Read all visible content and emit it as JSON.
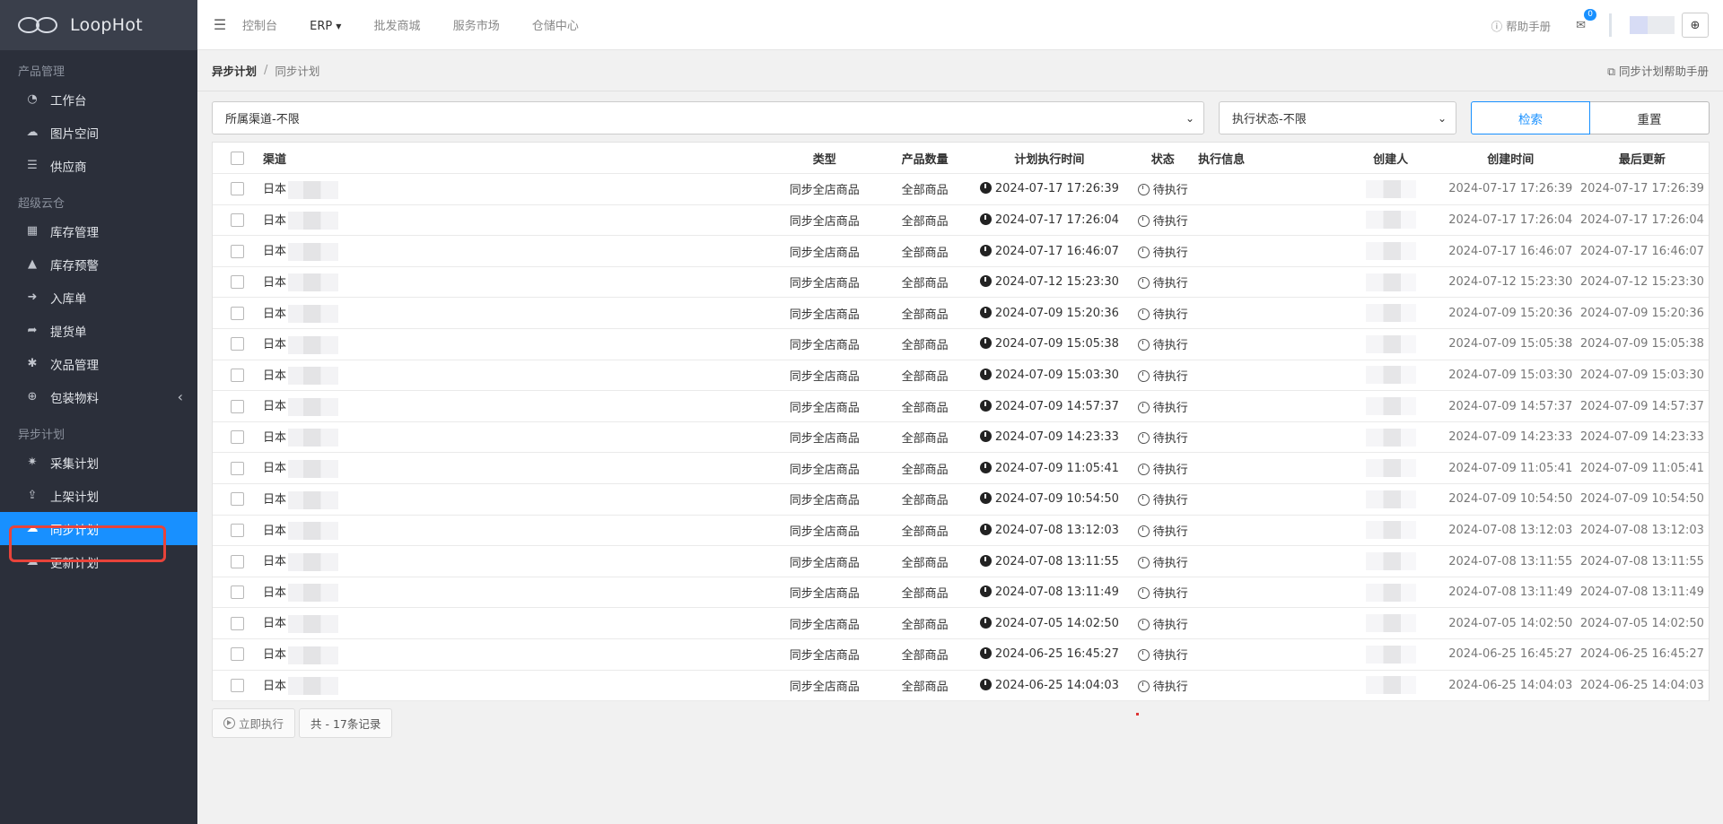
{
  "brand": {
    "name": "LoopHot"
  },
  "sidebar": {
    "groups": [
      {
        "title": "产品管理",
        "items": [
          {
            "label": "工作台",
            "icon": "dashboard-icon",
            "glyph": "◔"
          },
          {
            "label": "图片空间",
            "icon": "cloud-icon",
            "glyph": "☁"
          },
          {
            "label": "供应商",
            "icon": "list-icon",
            "glyph": "☰"
          }
        ]
      },
      {
        "title": "超级云仓",
        "items": [
          {
            "label": "库存管理",
            "icon": "cubes-icon",
            "glyph": "▦"
          },
          {
            "label": "库存预警",
            "icon": "warning-icon",
            "glyph": "▲"
          },
          {
            "label": "入库单",
            "icon": "sign-in-icon",
            "glyph": "➜"
          },
          {
            "label": "提货单",
            "icon": "sign-out-icon",
            "glyph": "➦"
          },
          {
            "label": "次品管理",
            "icon": "bug-icon",
            "glyph": "✱"
          },
          {
            "label": "包装物料",
            "icon": "search-plus-icon",
            "glyph": "⊕",
            "expandable": true
          }
        ]
      },
      {
        "title": "异步计划",
        "items": [
          {
            "label": "采集计划",
            "icon": "spider-icon",
            "glyph": "✷"
          },
          {
            "label": "上架计划",
            "icon": "upload-icon",
            "glyph": "⇪"
          },
          {
            "label": "同步计划",
            "icon": "cloud-download-icon",
            "glyph": "☁",
            "active": true
          },
          {
            "label": "更新计划",
            "icon": "cloud-upload-icon",
            "glyph": "☁"
          }
        ]
      }
    ]
  },
  "topbar": {
    "nav": [
      "控制台",
      "ERP",
      "批发商城",
      "服务市场",
      "仓储中心"
    ],
    "help": "帮助手册",
    "mail_badge": "0"
  },
  "breadcrumb": {
    "parent": "异步计划",
    "current": "同步计划",
    "help": "同步计划帮助手册"
  },
  "filters": {
    "channel": "所属渠道-不限",
    "status": "执行状态-不限",
    "search": "检索",
    "reset": "重置"
  },
  "table": {
    "columns": [
      "渠道",
      "类型",
      "产品数量",
      "计划执行时间",
      "状态",
      "执行信息",
      "创建人",
      "创建时间",
      "最后更新"
    ],
    "rows": [
      {
        "channel": "日本",
        "type": "同步全店商品",
        "qty": "全部商品",
        "plan_time": "2024-07-17 17:26:39",
        "status": "待执行",
        "created": "2024-07-17 17:26:39",
        "updated": "2024-07-17 17:26:39"
      },
      {
        "channel": "日本",
        "type": "同步全店商品",
        "qty": "全部商品",
        "plan_time": "2024-07-17 17:26:04",
        "status": "待执行",
        "created": "2024-07-17 17:26:04",
        "updated": "2024-07-17 17:26:04"
      },
      {
        "channel": "日本",
        "type": "同步全店商品",
        "qty": "全部商品",
        "plan_time": "2024-07-17 16:46:07",
        "status": "待执行",
        "created": "2024-07-17 16:46:07",
        "updated": "2024-07-17 16:46:07"
      },
      {
        "channel": "日本",
        "type": "同步全店商品",
        "qty": "全部商品",
        "plan_time": "2024-07-12 15:23:30",
        "status": "待执行",
        "created": "2024-07-12 15:23:30",
        "updated": "2024-07-12 15:23:30"
      },
      {
        "channel": "日本",
        "type": "同步全店商品",
        "qty": "全部商品",
        "plan_time": "2024-07-09 15:20:36",
        "status": "待执行",
        "created": "2024-07-09 15:20:36",
        "updated": "2024-07-09 15:20:36"
      },
      {
        "channel": "日本",
        "type": "同步全店商品",
        "qty": "全部商品",
        "plan_time": "2024-07-09 15:05:38",
        "status": "待执行",
        "created": "2024-07-09 15:05:38",
        "updated": "2024-07-09 15:05:38"
      },
      {
        "channel": "日本",
        "type": "同步全店商品",
        "qty": "全部商品",
        "plan_time": "2024-07-09 15:03:30",
        "status": "待执行",
        "created": "2024-07-09 15:03:30",
        "updated": "2024-07-09 15:03:30"
      },
      {
        "channel": "日本",
        "type": "同步全店商品",
        "qty": "全部商品",
        "plan_time": "2024-07-09 14:57:37",
        "status": "待执行",
        "created": "2024-07-09 14:57:37",
        "updated": "2024-07-09 14:57:37"
      },
      {
        "channel": "日本",
        "type": "同步全店商品",
        "qty": "全部商品",
        "plan_time": "2024-07-09 14:23:33",
        "status": "待执行",
        "created": "2024-07-09 14:23:33",
        "updated": "2024-07-09 14:23:33"
      },
      {
        "channel": "日本",
        "type": "同步全店商品",
        "qty": "全部商品",
        "plan_time": "2024-07-09 11:05:41",
        "status": "待执行",
        "created": "2024-07-09 11:05:41",
        "updated": "2024-07-09 11:05:41"
      },
      {
        "channel": "日本",
        "type": "同步全店商品",
        "qty": "全部商品",
        "plan_time": "2024-07-09 10:54:50",
        "status": "待执行",
        "created": "2024-07-09 10:54:50",
        "updated": "2024-07-09 10:54:50"
      },
      {
        "channel": "日本",
        "type": "同步全店商品",
        "qty": "全部商品",
        "plan_time": "2024-07-08 13:12:03",
        "status": "待执行",
        "created": "2024-07-08 13:12:03",
        "updated": "2024-07-08 13:12:03"
      },
      {
        "channel": "日本",
        "type": "同步全店商品",
        "qty": "全部商品",
        "plan_time": "2024-07-08 13:11:55",
        "status": "待执行",
        "created": "2024-07-08 13:11:55",
        "updated": "2024-07-08 13:11:55"
      },
      {
        "channel": "日本",
        "type": "同步全店商品",
        "qty": "全部商品",
        "plan_time": "2024-07-08 13:11:49",
        "status": "待执行",
        "created": "2024-07-08 13:11:49",
        "updated": "2024-07-08 13:11:49"
      },
      {
        "channel": "日本",
        "type": "同步全店商品",
        "qty": "全部商品",
        "plan_time": "2024-07-05 14:02:50",
        "status": "待执行",
        "created": "2024-07-05 14:02:50",
        "updated": "2024-07-05 14:02:50"
      },
      {
        "channel": "日本",
        "type": "同步全店商品",
        "qty": "全部商品",
        "plan_time": "2024-06-25 16:45:27",
        "status": "待执行",
        "created": "2024-06-25 16:45:27",
        "updated": "2024-06-25 16:45:27"
      },
      {
        "channel": "日本",
        "type": "同步全店商品",
        "qty": "全部商品",
        "plan_time": "2024-06-25 14:04:03",
        "status": "待执行",
        "created": "2024-06-25 14:04:03",
        "updated": "2024-06-25 14:04:03"
      }
    ]
  },
  "footer": {
    "execute": "立即执行",
    "count": "共 - 17条记录"
  },
  "colors": {
    "sidebar_bg": "#2b2f3a",
    "accent": "#1890ff",
    "highlight": "#e8433a"
  }
}
